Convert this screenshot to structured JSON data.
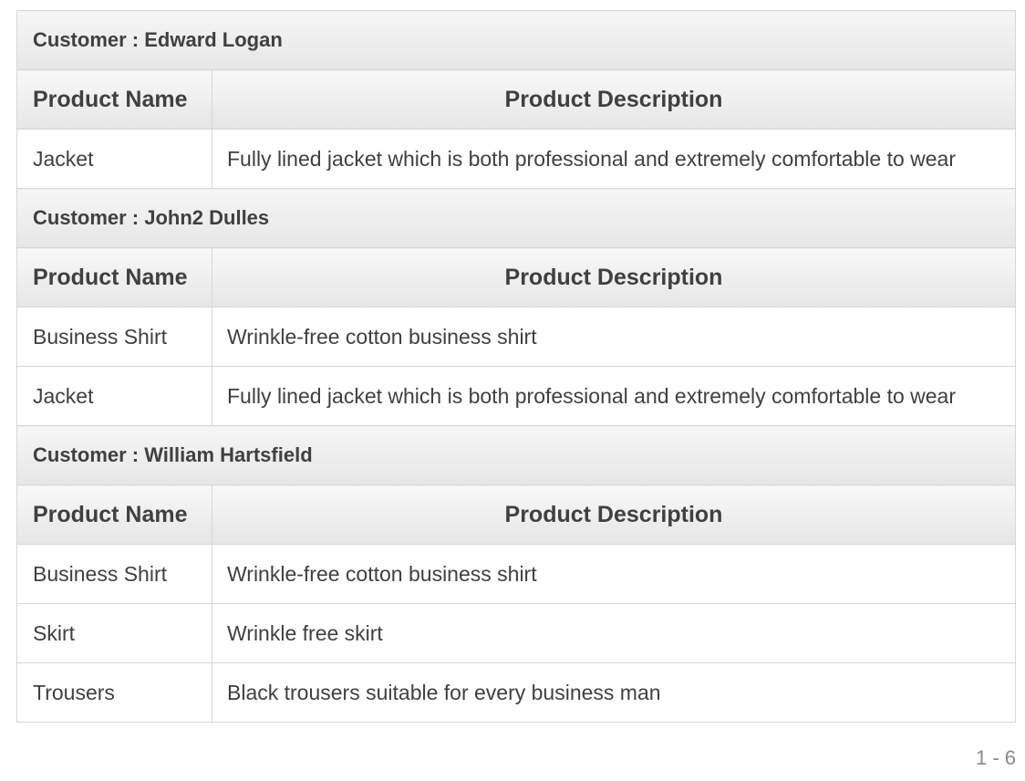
{
  "table": {
    "col_name_header": "Product Name",
    "col_desc_header": "Product Description",
    "groups": [
      {
        "customer_label": "Customer : Edward Logan",
        "rows": [
          {
            "name": "Jacket",
            "description": "Fully lined jacket which is both professional and extremely comfortable to wear"
          }
        ]
      },
      {
        "customer_label": "Customer : John2 Dulles",
        "rows": [
          {
            "name": "Business Shirt",
            "description": "Wrinkle-free cotton business shirt"
          },
          {
            "name": "Jacket",
            "description": "Fully lined jacket which is both professional and extremely comfortable to wear"
          }
        ]
      },
      {
        "customer_label": "Customer : William Hartsfield",
        "rows": [
          {
            "name": "Business Shirt",
            "description": "Wrinkle-free cotton business shirt"
          },
          {
            "name": "Skirt",
            "description": "Wrinkle free skirt"
          },
          {
            "name": "Trousers",
            "description": "Black trousers suitable for every business man"
          }
        ]
      }
    ]
  },
  "pagination": {
    "range": "1 - 6"
  }
}
